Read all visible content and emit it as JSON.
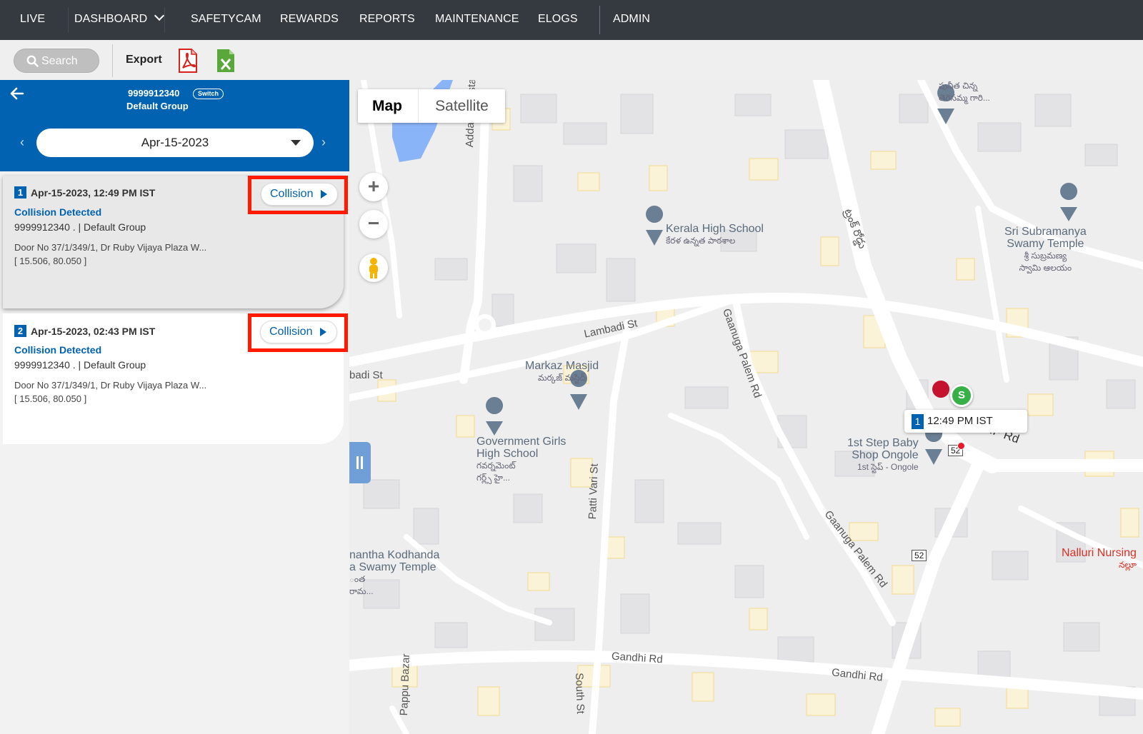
{
  "nav": {
    "items": [
      "LIVE",
      "DASHBOARD",
      "SAFETYCAM",
      "REWARDS",
      "REPORTS",
      "MAINTENANCE",
      "ELOGS",
      "ADMIN"
    ]
  },
  "toolbar": {
    "search_label": "Search",
    "export_label": "Export",
    "icons": [
      "search-icon",
      "pdf-icon",
      "excel-icon"
    ]
  },
  "panel": {
    "device_id": "9999912340",
    "switch_label": "Switch",
    "group": "Default Group",
    "date": "Apr-15-2023",
    "prev_glyph": "‹",
    "next_glyph": "›"
  },
  "events": [
    {
      "number": "1",
      "time": "Apr-15-2023, 12:49 PM IST",
      "title": "Collision Detected",
      "sub": "9999912340 . | Default Group",
      "address": "Door No 37/1/349/1, Dr Ruby Vijaya Plaza W...",
      "coords": "[ 15.506, 80.050 ]",
      "button": "Collision"
    },
    {
      "number": "2",
      "time": "Apr-15-2023, 02:43 PM IST",
      "title": "Collision Detected",
      "sub": "9999912340 . | Default Group",
      "address": "Door No 37/1/349/1, Dr Ruby Vijaya Plaza W...",
      "coords": "[ 15.506, 80.050 ]",
      "button": "Collision"
    }
  ],
  "map": {
    "type_map": "Map",
    "type_satellite": "Satellite",
    "zoom_in": "+",
    "zoom_out": "−",
    "marker_start": "S",
    "tooltip_num": "1",
    "tooltip_time": "12:49 PM IST",
    "streets": {
      "addanki": "Addanki Bustal",
      "lambadi": "Lambadi St",
      "lambadi_left": "badi St",
      "ganuga1": "Gaanuga Palem Rd",
      "ganuga2": "Gaanuga Palem Rd",
      "kp": "K.P Rd",
      "patti": "Patti Vari St",
      "gandhi1": "Gandhi Rd",
      "gandhi2": "Gandhi Rd",
      "pappu": "Pappu Bazar",
      "south": "South St",
      "telugu_road": "ట్రంక్ రోడ్డు"
    },
    "pois": {
      "kerala_en": "Kerala High School",
      "kerala_te": "కేరళ ఉన్నత పాఠశాల",
      "subram_en1": "Sri Subramanya",
      "subram_en2": "Swamy Temple",
      "subram_te1": "శ్రీ సుబ్రమణ్య",
      "subram_te2": "స్వామి ఆలయం",
      "masjid_en": "Markaz Masjid",
      "masjid_te": "మర్కజ్ మస్జిద్",
      "ggh_en1": "Government Girls",
      "ggh_en2": "High School",
      "ggh_te1": "గవర్నమెంట్",
      "ggh_te2": "గర్ల్స్ హై...",
      "baby_en1": "1st Step Baby",
      "baby_en2": "Shop Ongole",
      "baby_te": "1st స్టెప్ - Ongole",
      "kodanda1": "nantha Kodhanda",
      "kodanda2": "a Swamy Temple",
      "kodanda3": "ంత",
      "kodanda4": "రామ...",
      "nalluri": "Nalluri Nursing",
      "nalluri_te": "నల్లూ",
      "top_te1": "పునీత చిన్న",
      "top_te2": "తెరెసమ్మ గారి..."
    },
    "route_shield": "52"
  },
  "colors": {
    "nav_bg": "#343a40",
    "brand_blue": "#0062b1",
    "highlight_red": "#ff1a00",
    "start_green": "#38b048"
  }
}
